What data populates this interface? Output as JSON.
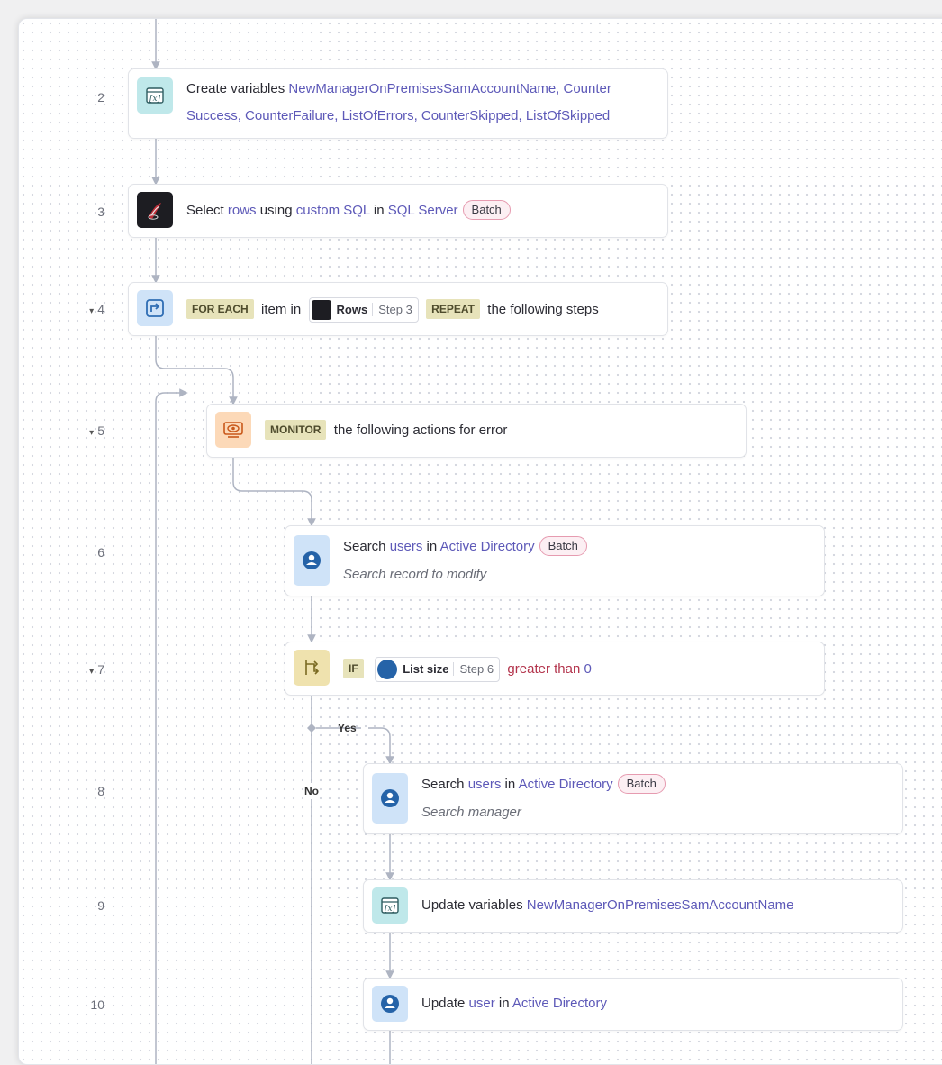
{
  "steps": [
    {
      "num": "2",
      "collapsible": false,
      "text_a": "Create variables ",
      "link_a": "NewManagerOnPremisesSamAccountName, Counter",
      "link_b": "Success, CounterFailure, ListOfErrors, CounterSkipped, ListOfSkipped",
      "icon": "variables-icon"
    },
    {
      "num": "3",
      "collapsible": false,
      "text_a": "Select ",
      "link_a": "rows",
      "text_b": " using ",
      "link_b": "custom SQL",
      "text_c": " in ",
      "link_c": "SQL Server",
      "badge": "Batch",
      "icon": "sql-server-icon"
    },
    {
      "num": "4",
      "collapsible": true,
      "kw1": "FOR EACH",
      "text_a": "item in",
      "pill_name": "Rows",
      "pill_step": "Step 3",
      "kw2": "REPEAT",
      "text_b": "the following steps",
      "icon": "repeat-icon"
    },
    {
      "num": "5",
      "collapsible": true,
      "kw1": "MONITOR",
      "text_a": "the following actions for error",
      "icon": "monitor-icon"
    },
    {
      "num": "6",
      "collapsible": false,
      "text_a": "Search ",
      "link_a": "users",
      "text_b": " in ",
      "link_b": "Active Directory",
      "badge": "Batch",
      "subtitle": "Search record to modify",
      "icon": "ldap-icon"
    },
    {
      "num": "7",
      "collapsible": true,
      "kw1": "IF",
      "pill_name": "List size",
      "pill_step": "Step 6",
      "cond_a": "greater than",
      "cond_b": "0",
      "icon": "if-condition-icon"
    },
    {
      "num": "8",
      "collapsible": false,
      "text_a": "Search ",
      "link_a": "users",
      "text_b": " in ",
      "link_b": "Active Directory",
      "badge": "Batch",
      "subtitle": "Search manager",
      "icon": "ldap-icon"
    },
    {
      "num": "9",
      "collapsible": false,
      "text_a": "Update variables ",
      "link_a": "NewManagerOnPremisesSamAccountName",
      "icon": "variables-icon"
    },
    {
      "num": "10",
      "collapsible": false,
      "text_a": "Update ",
      "link_a": "user",
      "text_b": " in ",
      "link_b": "Active Directory",
      "icon": "ldap-icon"
    }
  ],
  "branches": {
    "yes": "Yes",
    "no": "No"
  },
  "collapse_glyph": "▾",
  "colors": {
    "link": "#5d59b8",
    "condition": "#b3344c",
    "keyword_bg": "#e7e3ba",
    "badge_border": "#e69bb0",
    "connector": "#aeb4c2"
  }
}
